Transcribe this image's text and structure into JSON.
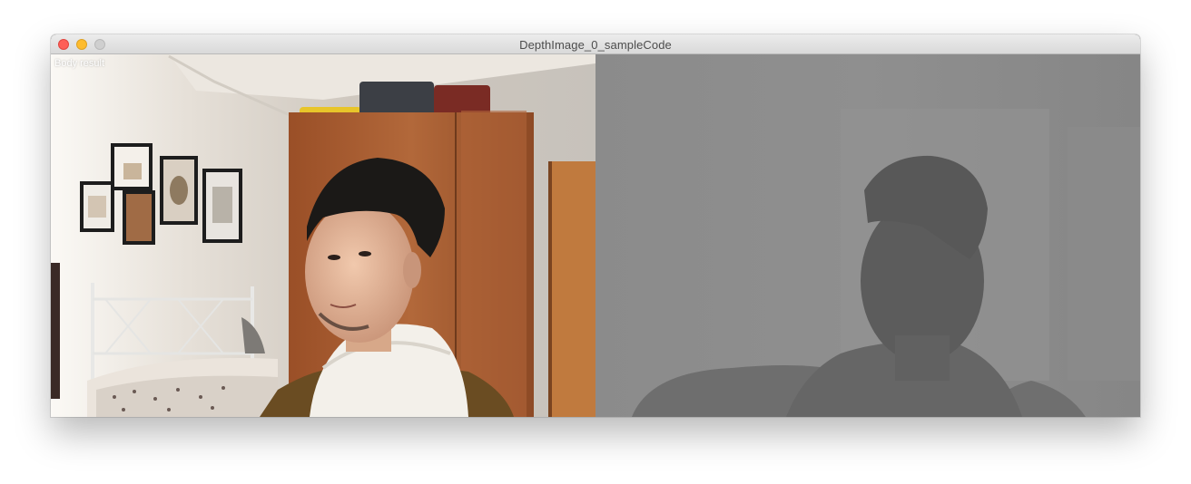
{
  "window": {
    "title": "DepthImage_0_sampleCode"
  },
  "camera_view": {
    "overlay_label": "Body result"
  },
  "colors": {
    "close": "#fe5f57",
    "minimize": "#febc2e",
    "zoom": "#cfcfcf",
    "depth_background": "#8a8a8a"
  }
}
